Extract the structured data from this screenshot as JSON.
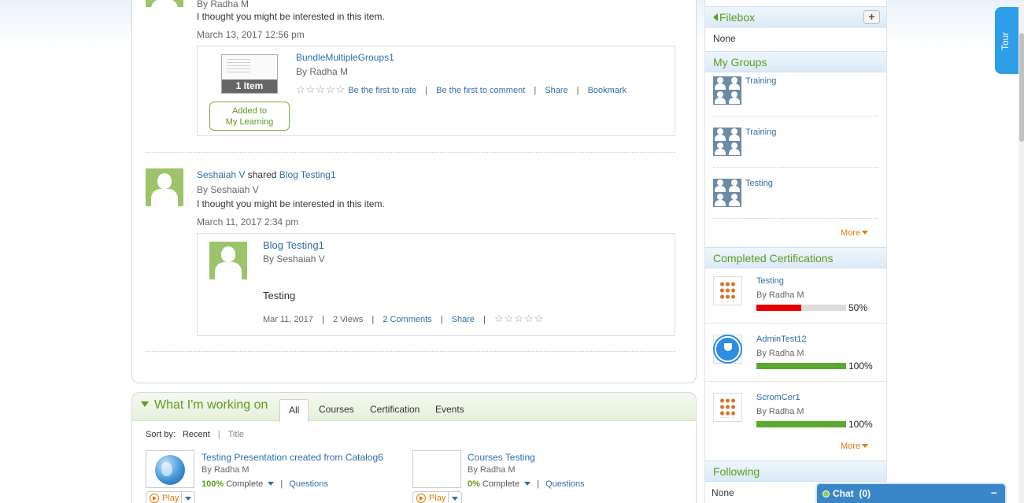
{
  "feed": {
    "items": [
      {
        "by": "By Radha M",
        "message": "I thought you might be interested in this item.",
        "date": "March 13, 2017 12:56 pm",
        "card": {
          "thumb_badge": "1 Item",
          "added_label_1": "Added to",
          "added_label_2": "My Learning",
          "title": "BundleMultipleGroups1",
          "by": "By Radha M",
          "rate_link": "Be the first to rate",
          "comment_link": "Be the first to comment",
          "share_link": "Share",
          "bookmark_link": "Bookmark",
          "sep": "|"
        }
      },
      {
        "actor": "Seshaiah V",
        "verb": "shared",
        "object": "Blog Testing1",
        "by": "By Seshaiah V",
        "message": "I thought you might be interested in this item.",
        "date": "March 11, 2017 2:34 pm",
        "card": {
          "title": "Blog Testing1",
          "by": "By Seshaiah V",
          "body": "Testing",
          "date": "Mar 11, 2017",
          "views": "2 Views",
          "comments_link": "2 Comments",
          "share_link": "Share",
          "sep": "|"
        }
      }
    ],
    "stars": "☆☆☆☆☆"
  },
  "working": {
    "title": "What I'm working on",
    "tabs": [
      "All",
      "Courses",
      "Certification",
      "Events"
    ],
    "sort_label": "Sort by:",
    "sort_recent": "Recent",
    "sort_sep": "|",
    "sort_title": "Title",
    "items": [
      {
        "title": "Testing Presentation created from Catalog6",
        "by": "By Radha M",
        "percent": "100%",
        "complete_label": "Complete",
        "questions_link": "Questions",
        "sep": "|",
        "play_label": "Play"
      },
      {
        "title": "Courses Testing",
        "by": "By Radha M",
        "percent": "0%",
        "complete_label": "Complete",
        "questions_link": "Questions",
        "sep": "|",
        "play_label": "Play"
      }
    ]
  },
  "sidebar": {
    "filebox": {
      "title": "Filebox",
      "plus": "+",
      "value": "None"
    },
    "groups": {
      "title": "My Groups",
      "items": [
        "Training",
        "Training",
        "Testing"
      ],
      "more": "More"
    },
    "certifications": {
      "title": "Completed Certifications",
      "items": [
        {
          "name": "Testing",
          "by": "By Radha M",
          "percent": "50%",
          "progress": 0.5,
          "color": "#e60000"
        },
        {
          "name": "AdminTest12",
          "by": "By Radha M",
          "percent": "100%",
          "progress": 1.0,
          "color": "#5aaa32"
        },
        {
          "name": "ScromCer1",
          "by": "By Radha M",
          "percent": "100%",
          "progress": 1.0,
          "color": "#5aaa32"
        }
      ],
      "more": "More"
    },
    "following": {
      "title": "Following",
      "value": "None"
    }
  },
  "tour": {
    "label": "Tour"
  },
  "chat": {
    "label": "Chat  (0)",
    "minimize": "−"
  },
  "colors": {
    "accent_green": "#5e9a1e",
    "link_blue": "#2f6fa8",
    "orange": "#e07a10"
  }
}
